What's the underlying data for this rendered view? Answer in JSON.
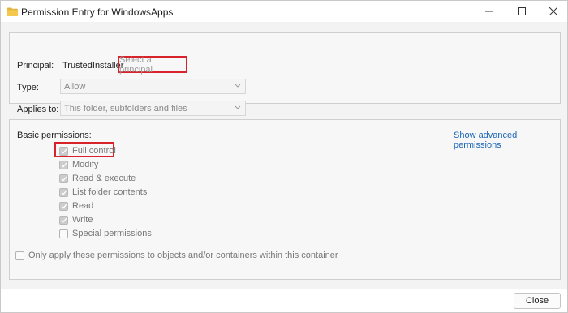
{
  "window": {
    "title": "Permission Entry for WindowsApps"
  },
  "principal": {
    "label": "Principal:",
    "value": "TrustedInstaller",
    "select_link": "Select a principal"
  },
  "type": {
    "label": "Type:",
    "value": "Allow"
  },
  "applies_to": {
    "label": "Applies to:",
    "value": "This folder, subfolders and files"
  },
  "permissions": {
    "header": "Basic permissions:",
    "advanced_link": "Show advanced permissions",
    "items": [
      {
        "label": "Full control",
        "checked": true
      },
      {
        "label": "Modify",
        "checked": true
      },
      {
        "label": "Read & execute",
        "checked": true
      },
      {
        "label": "List folder contents",
        "checked": true
      },
      {
        "label": "Read",
        "checked": true
      },
      {
        "label": "Write",
        "checked": true
      },
      {
        "label": "Special permissions",
        "checked": false
      }
    ],
    "only_apply": {
      "label": "Only apply these permissions to objects and/or containers within this container",
      "checked": false
    }
  },
  "footer": {
    "close_label": "Close"
  },
  "colors": {
    "highlight_box": "#d8232a",
    "link": "#1a66b8",
    "folder_icon": "#e8b33a"
  }
}
